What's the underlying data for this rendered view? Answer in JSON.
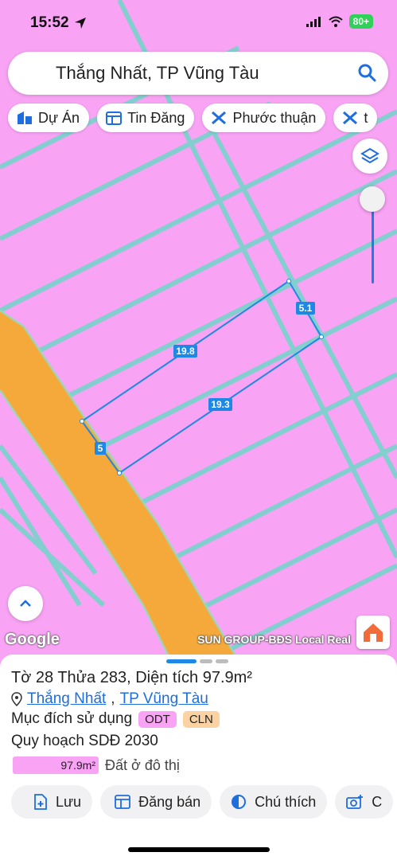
{
  "status": {
    "time": "15:52",
    "battery": "80+"
  },
  "search": {
    "query": "Thắng Nhất, TP Vũng Tàu"
  },
  "chips": [
    {
      "label": "Dự Án",
      "icon": "building-icon"
    },
    {
      "label": "Tin Đăng",
      "icon": "listing-icon"
    },
    {
      "label": "Phước thuận",
      "icon": "tools-icon"
    },
    {
      "label": "t",
      "icon": "tools-icon"
    }
  ],
  "map": {
    "colors": {
      "land": "#f8a3f4",
      "road": "#f5a93a",
      "parcel_edge": "#6fd6c8",
      "selection": "#1e88e5"
    },
    "edge_labels": [
      "19.8",
      "5.1",
      "19.3",
      "5"
    ],
    "google": "Google",
    "attribution": "SUN GROUP-BĐS Local Real"
  },
  "sheet": {
    "title": "Tờ 28 Thửa 283, Diện tích 97.9m²",
    "address_ward": "Thắng Nhất",
    "address_sep": ",",
    "address_city": "TP Vũng Tàu",
    "usage_label": "Mục đích sử dụng",
    "tags": [
      {
        "text": "ODT",
        "color": "#f8a3f4"
      },
      {
        "text": "CLN",
        "color": "#fbd3a2"
      }
    ],
    "plan_label": "Quy hoạch SDĐ 2030",
    "plan_area": "97.9m²",
    "plan_desc": "Đất ở đô thị"
  },
  "actions": [
    {
      "label": "Lưu",
      "icon": "add-file-icon"
    },
    {
      "label": "Đăng bán",
      "icon": "listing-icon"
    },
    {
      "label": "Chú thích",
      "icon": "contrast-icon"
    },
    {
      "label": "C",
      "icon": "add-photo-icon"
    }
  ]
}
